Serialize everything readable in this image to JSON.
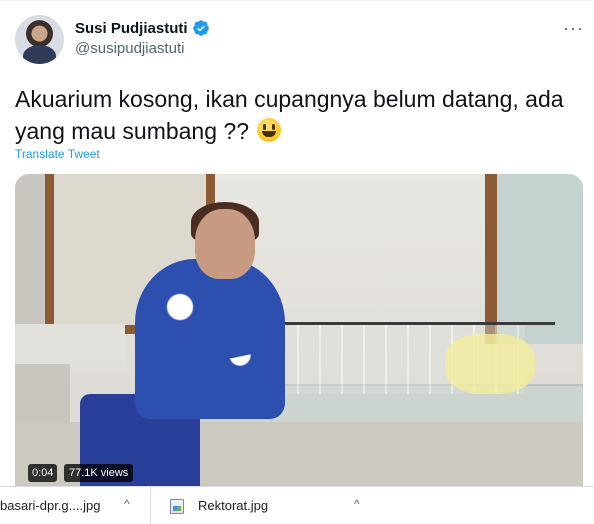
{
  "tweet": {
    "author_name": "Susi Pudjiastuti",
    "author_handle": "@susipudjiastuti",
    "more_label": "···",
    "text": "Akuarium kosong, ikan cupangnya belum datang, ada yang mau sumbang ??",
    "translate_label": "Translate Tweet",
    "video": {
      "time": "0:04",
      "views": "77.1K views"
    }
  },
  "downloads": [
    {
      "label": "basari-dpr.g....jpg",
      "chevron": "^"
    },
    {
      "label": "Rektorat.jpg",
      "chevron": "^"
    }
  ],
  "icons": {
    "verified": "verified-badge-icon",
    "emoji": "grinning-face-emoji",
    "file": "image-file-icon"
  },
  "colors": {
    "accent": "#1d9bf0",
    "text": "#0f1419",
    "muted": "#536471"
  }
}
